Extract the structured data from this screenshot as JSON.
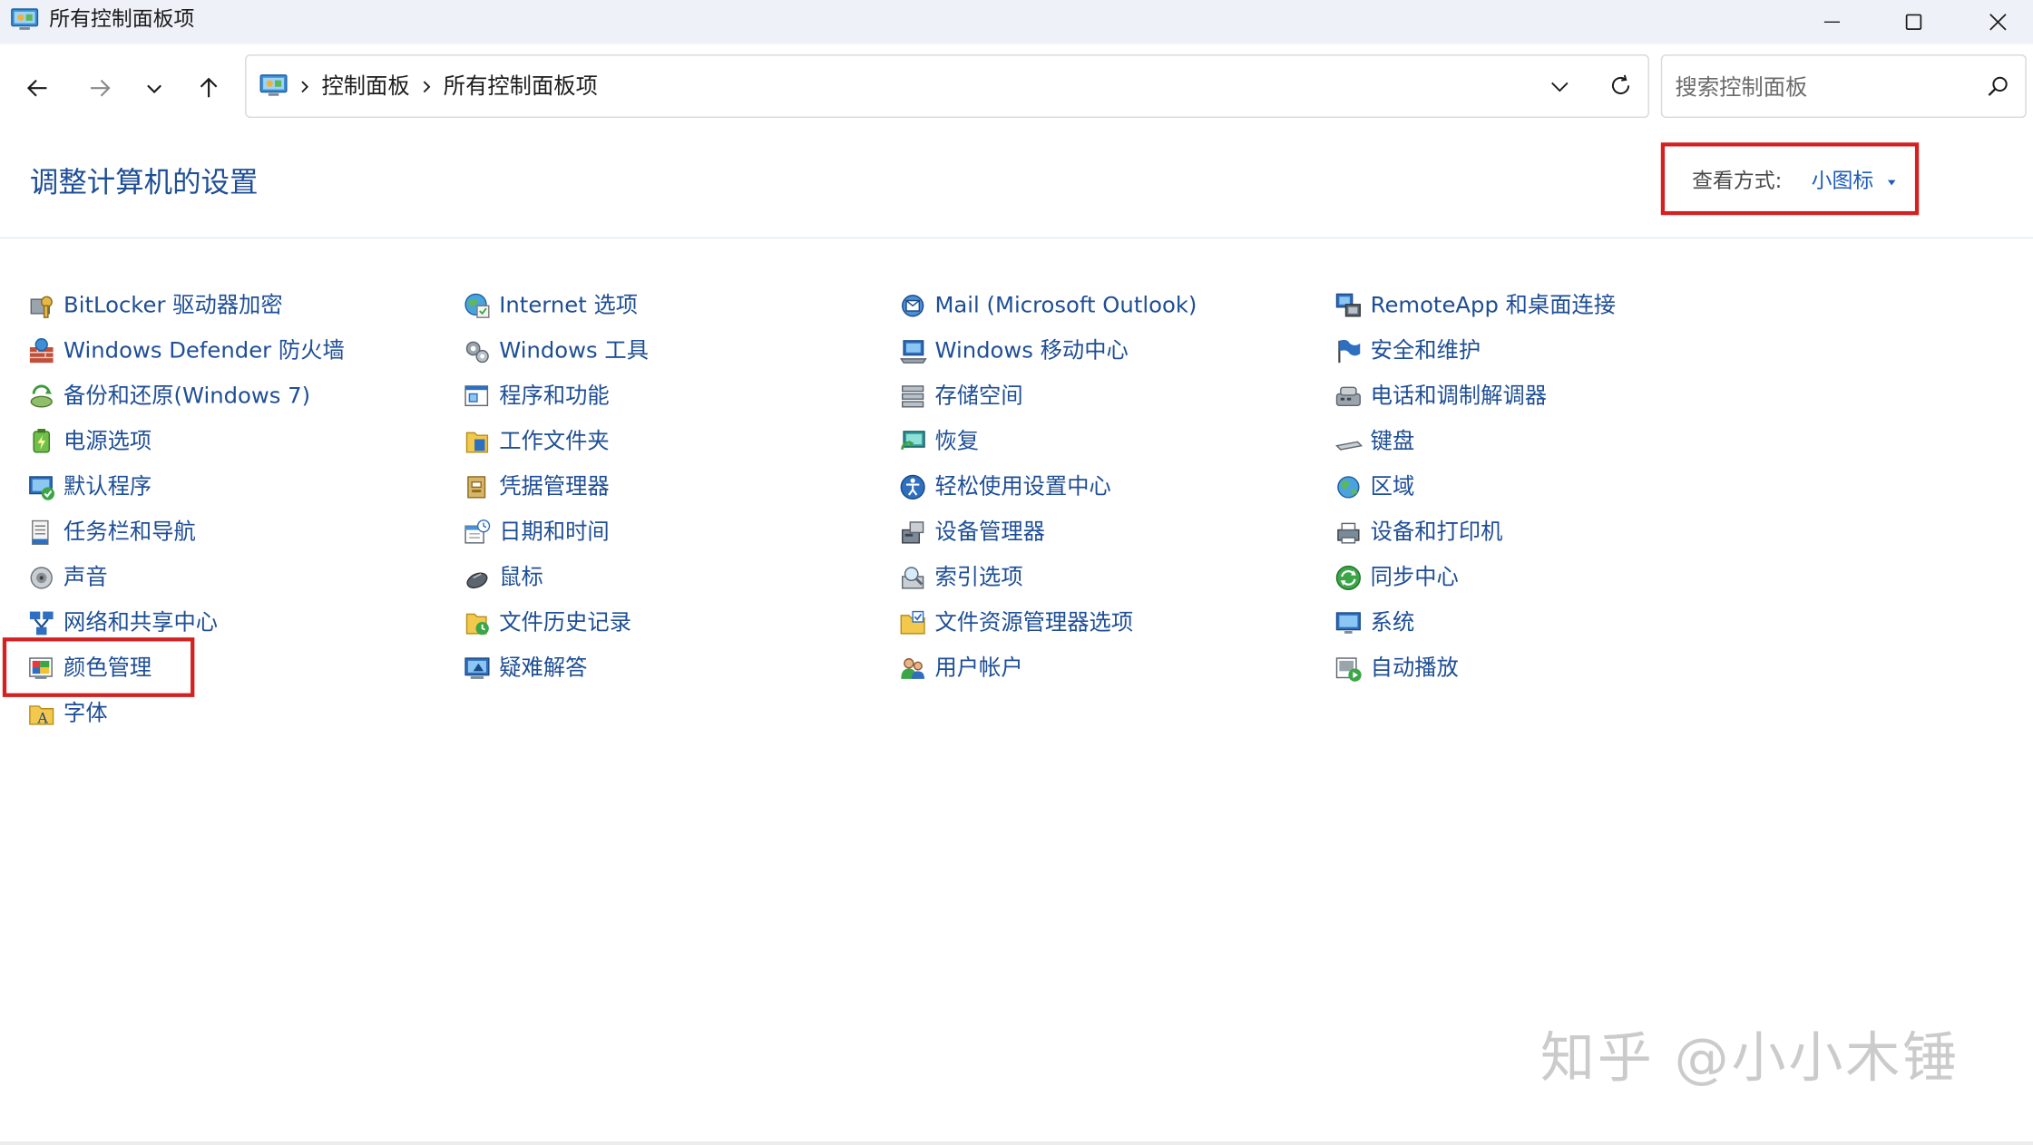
{
  "window": {
    "title": "所有控制面板项",
    "minimize_icon": "minimize-icon",
    "maximize_icon": "maximize-icon",
    "close_icon": "close-icon"
  },
  "nav": {
    "back_icon": "arrow-left-icon",
    "forward_icon": "arrow-right-icon",
    "recent_icon": "chevron-down-icon",
    "up_icon": "arrow-up-icon"
  },
  "address": {
    "crumbs": [
      "控制面板",
      "所有控制面板项"
    ],
    "refresh_icon": "refresh-icon"
  },
  "search": {
    "placeholder": "搜索控制面板",
    "value": ""
  },
  "header": {
    "heading": "调整计算机的设置",
    "view_by_label": "查看方式:",
    "view_by_value": "小图标"
  },
  "items": {
    "col1": [
      {
        "label": "BitLocker 驱动器加密",
        "icon": "bitlocker-icon"
      },
      {
        "label": "Windows Defender 防火墙",
        "icon": "firewall-icon"
      },
      {
        "label": "备份和还原(Windows 7)",
        "icon": "backup-icon"
      },
      {
        "label": "电源选项",
        "icon": "power-icon"
      },
      {
        "label": "默认程序",
        "icon": "default-programs-icon"
      },
      {
        "label": "任务栏和导航",
        "icon": "taskbar-icon"
      },
      {
        "label": "声音",
        "icon": "sound-icon"
      },
      {
        "label": "网络和共享中心",
        "icon": "network-icon"
      },
      {
        "label": "颜色管理",
        "icon": "color-management-icon"
      },
      {
        "label": "字体",
        "icon": "fonts-icon"
      }
    ],
    "col2": [
      {
        "label": "Internet 选项",
        "icon": "internet-options-icon"
      },
      {
        "label": "Windows 工具",
        "icon": "windows-tools-icon"
      },
      {
        "label": "程序和功能",
        "icon": "programs-icon"
      },
      {
        "label": "工作文件夹",
        "icon": "work-folders-icon"
      },
      {
        "label": "凭据管理器",
        "icon": "credential-icon"
      },
      {
        "label": "日期和时间",
        "icon": "datetime-icon"
      },
      {
        "label": "鼠标",
        "icon": "mouse-icon"
      },
      {
        "label": "文件历史记录",
        "icon": "file-history-icon"
      },
      {
        "label": "疑难解答",
        "icon": "troubleshoot-icon"
      }
    ],
    "col3": [
      {
        "label": "Mail (Microsoft Outlook)",
        "icon": "mail-icon"
      },
      {
        "label": "Windows 移动中心",
        "icon": "mobility-icon"
      },
      {
        "label": "存储空间",
        "icon": "storage-icon"
      },
      {
        "label": "恢复",
        "icon": "recovery-icon"
      },
      {
        "label": "轻松使用设置中心",
        "icon": "accessibility-icon"
      },
      {
        "label": "设备管理器",
        "icon": "device-manager-icon"
      },
      {
        "label": "索引选项",
        "icon": "indexing-icon"
      },
      {
        "label": "文件资源管理器选项",
        "icon": "folder-options-icon"
      },
      {
        "label": "用户帐户",
        "icon": "user-accounts-icon"
      }
    ],
    "col4": [
      {
        "label": "RemoteApp 和桌面连接",
        "icon": "remoteapp-icon"
      },
      {
        "label": "安全和维护",
        "icon": "security-flag-icon"
      },
      {
        "label": "电话和调制解调器",
        "icon": "phone-modem-icon"
      },
      {
        "label": "键盘",
        "icon": "keyboard-icon"
      },
      {
        "label": "区域",
        "icon": "region-icon"
      },
      {
        "label": "设备和打印机",
        "icon": "printer-icon"
      },
      {
        "label": "同步中心",
        "icon": "sync-icon"
      },
      {
        "label": "系统",
        "icon": "system-icon"
      },
      {
        "label": "自动播放",
        "icon": "autoplay-icon"
      }
    ]
  },
  "watermark": "知乎 @小小木锤",
  "colors": {
    "link": "#1e4e96",
    "highlight": "#d42020",
    "titlebar": "#eef2f8"
  }
}
